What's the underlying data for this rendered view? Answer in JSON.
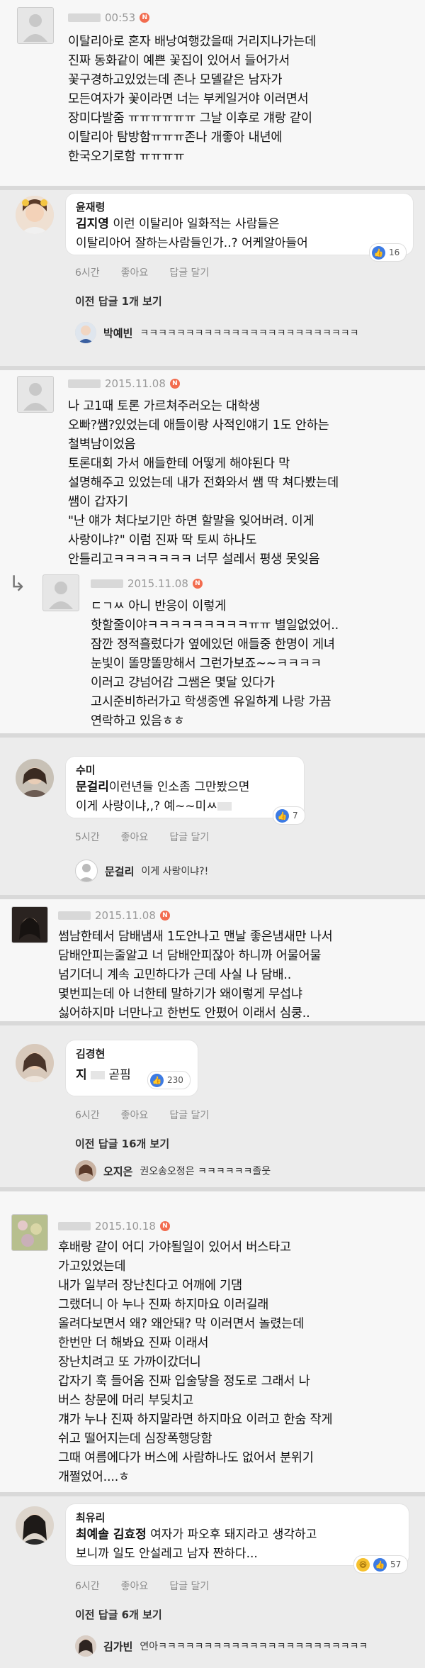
{
  "comments": [
    {
      "meta": "00:53",
      "badge": "N",
      "text": "이탈리아로 혼자 배낭여행갔을때 거리지나가는데\n진짜 동화같이 예쁜 꽃집이 있어서 들어가서\n꽃구경하고있었는데 존나 모델같은 남자가\n모든여자가 꽃이라면 너는 부케일거야 이러면서\n장미다발줌 ㅠㅠㅠㅠㅠㅠ 그날 이후로 걔랑 같이\n이탈리아 탐방함ㅠㅠㅠ존나 개좋아 내년에\n한국오기로함 ㅠㅠㅠㅠ",
      "reply": {
        "name": "윤재령",
        "mention": "김지영",
        "text_line1": " 이런 이탈리아 일화적는 사람들은",
        "text_line2": "이탈리아어 잘하는사람들인가..? 어케알아들어",
        "likes": "16",
        "time": "6시간",
        "like_label": "좋아요",
        "reply_label": "답글 달기",
        "more": "이전 답글 1개 보기",
        "sub_name": "박예빈",
        "sub_text": "ㅋㅋㅋㅋㅋㅋㅋㅋㅋㅋㅋㅋㅋㅋㅋㅋㅋㅋㅋㅋㅋㅋㅋㅋ"
      }
    },
    {
      "meta": "2015.11.08",
      "badge": "N",
      "text": "나 고1때 토론 가르쳐주러오는 대학생\n오빠?쌤?있었는데 애들이랑 사적인얘기 1도 안하는\n철벽남이었음\n토론대회 가서 애들한테 어떻게 해야된다 막\n설명해주고 있었는데 내가 전화와서 쌤 딱 쳐다봤는데\n쌤이 갑자기\n\"난 얘가 쳐다보기만 하면 할말을 잊어버려. 이게\n사랑이냐?\" 이럼 진짜 딱 토씨 하나도\n안틀리고ㅋㅋㅋㅋㅋㅋㅋ 너무 설레서 평생 못잊음",
      "sub": {
        "meta": "2015.11.08",
        "badge": "N",
        "text": "ㄷㄱㅆ 아니 반응이 이렇게\n핫할줄이야ㅋㅋㅋㅋㅋㅋㅋㅋㅋㅠㅠ 별일없었어..\n잠깐 정적흘렀다가 옆에있던 애들중 한명이 게녀\n눈빛이 똘망똘망해서 그런가보죠~~ㅋㅋㅋㅋ\n이러고 걍넘어감 그쌤은 몇달 있다가\n고시준비하러가고 학생중엔 유일하게 나랑 가끔\n연락하고 있음ㅎㅎ"
      },
      "reply": {
        "name": "수미",
        "mention": "문걸리",
        "text_line1": "이런년들 인소좀 그만봤으면",
        "text_line2": "이게 사랑이냐,,? 예~~미ㅆ",
        "likes": "7",
        "time": "5시간",
        "like_label": "좋아요",
        "reply_label": "답글 달기",
        "sub_name": "문걸리",
        "sub_text": "이게 사랑이냐?!"
      }
    },
    {
      "meta": "2015.11.08",
      "badge": "N",
      "text": "썸남한테서 담배냄새 1도안나고 맨날 좋은냄새만 나서\n담배안피는줄알고 너 담배안피잖아 하니까 어물어물\n넘기더니 계속 고민하다가 근데 사실 나 담배..\n몇번피는데 아 너한테 말하기가 왜이렇게 무섭냐\n싫어하지마 너만나고 한번도 안폈어 이래서 심쿵..",
      "reply": {
        "name": "김경현",
        "mention": "지",
        "text_line1": "곧핌",
        "likes": "230",
        "time": "6시간",
        "like_label": "좋아요",
        "reply_label": "답글 달기",
        "more": "이전 답글 16개 보기",
        "sub_name": "오지은",
        "sub_text": "권오송오정은 ㅋㅋㅋㅋㅋㅋ졸웃"
      }
    },
    {
      "meta": "2015.10.18",
      "badge": "N",
      "text": "후배랑 같이 어디 가야될일이 있어서 버스타고\n가고있었는데\n내가 일부러 장난친다고 어깨에 기댐\n그랬더니 아 누나 진짜 하지마요 이러길래\n올려다보면서 왜? 왜안돼? 막 이러면서 놀렸는데\n한번만 더 해봐요 진짜 이래서\n장난치려고 또 가까이갔더니\n갑자기 훅 들어옴 진짜 입술닿을 정도로 그래서 나\n버스 창문에 머리 부딪치고\n걔가 누나 진짜 하지말라면 하지마요 이러고 한숨 작게\n쉬고 떨어지는데 심장폭행당함\n그때 여름에다가 버스에 사람하나도 없어서 분위기\n개쩔었어....ㅎ",
      "reply": {
        "name": "최유리",
        "mention": "최예솔 김효정",
        "text_line1": " 여자가 파오후    돼지라고 생각하고",
        "text_line2": "보니까 일도 안설레고 남자 짠하다...",
        "likes": "57",
        "time": "6시간",
        "like_label": "좋아요",
        "reply_label": "답글 달기",
        "more": "이전 답글 6개 보기",
        "sub_name": "김가빈",
        "sub_text": "연아ㅋㅋㅋㅋㅋㅋㅋㅋㅋㅋㅋㅋㅋㅋㅋㅋㅋㅋㅋㅋㅋㅋㅋ"
      }
    }
  ],
  "icons": {
    "reply_arrow": "↳",
    "like": "thumbs-up-icon",
    "haha": "haha-emoji-icon"
  }
}
